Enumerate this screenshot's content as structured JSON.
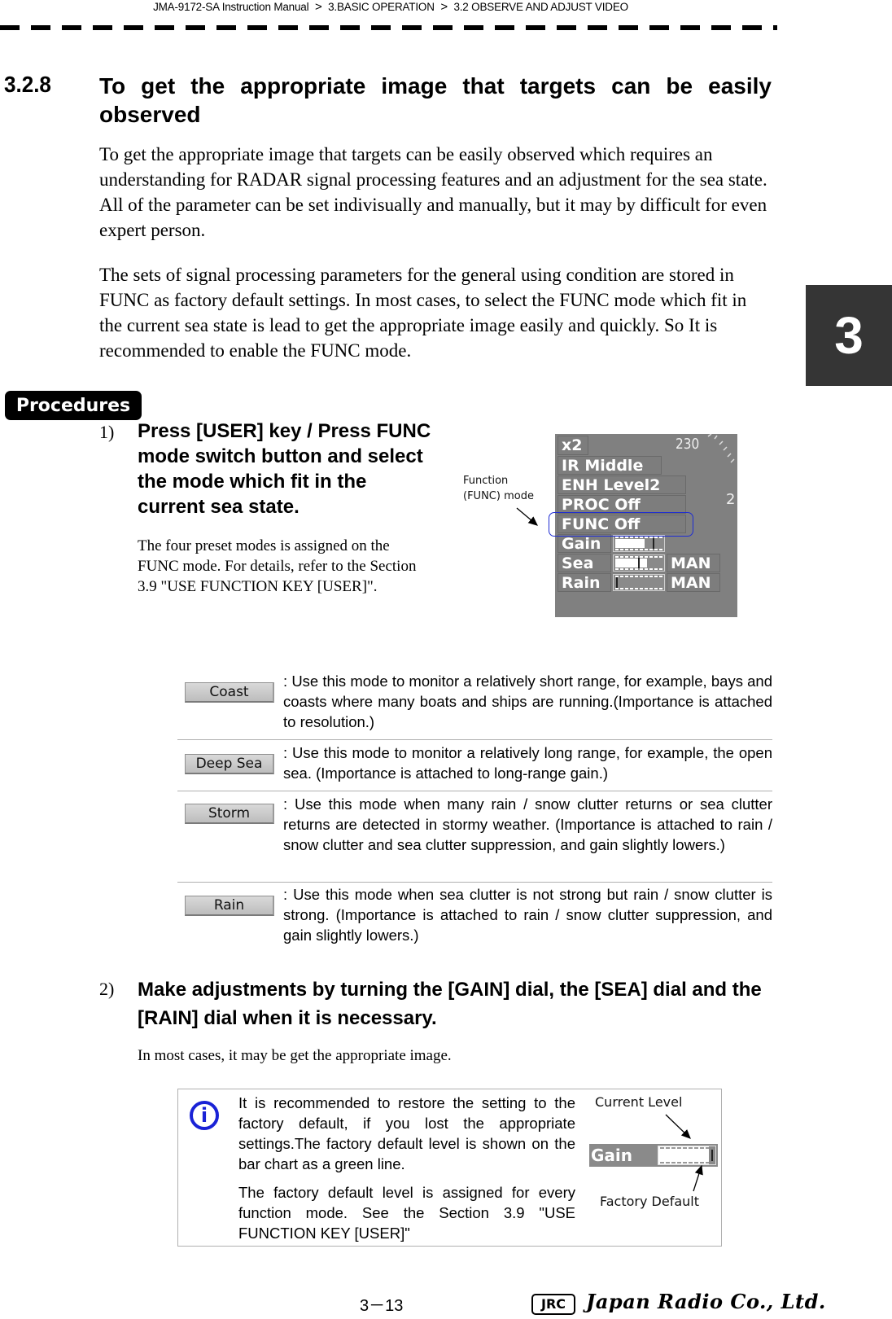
{
  "header": {
    "breadcrumb": [
      "JMA-9172-SA Instruction Manual",
      "3.BASIC OPERATION",
      "3.2  OBSERVE AND ADJUST VIDEO"
    ],
    "separator": ">"
  },
  "chapter_tab": "3",
  "section": {
    "number": "3.2.8",
    "title": "To get the appropriate image that targets can be easily observed",
    "paragraphs": [
      "To get the appropriate image that targets can be easily observed which requires an understanding for RADAR signal processing features and an adjustment for the sea state. All of the parameter can be set indivisually and manually, but it may by difficult for even expert person.",
      "The sets of signal processing parameters for the general using condition are stored in FUNC as factory default settings. In most cases, to select the FUNC mode which fit in the current sea state is lead to get the appropriate image easily and quickly. So It is recommended to enable the FUNC mode."
    ]
  },
  "procedures_label": "Procedures",
  "steps": [
    {
      "number": "1)",
      "title": "Press [USER] key / Press FUNC mode switch button and select the mode which fit in the current sea state.",
      "body": "The four preset modes is assigned on the FUNC mode. For details, refer to the Section 3.9 \"USE FUNCTION KEY [USER]\"."
    },
    {
      "number": "2)",
      "title": "Make adjustments by turning the [GAIN] dial, the [SEA] dial and the [RAIN] dial when it is necessary.",
      "body": "In most cases, it may be get the appropriate image."
    }
  ],
  "radar_figure": {
    "callout": [
      "Function",
      "(FUNC) mode"
    ],
    "range_readout": "230",
    "rows": [
      {
        "label": "x2"
      },
      {
        "label": "IR  Middle"
      },
      {
        "label": "ENH  Level2"
      },
      {
        "label": "PROC  Off"
      },
      {
        "label": "FUNC  Off"
      }
    ],
    "level_rows": [
      {
        "label": "Gain",
        "level_fraction": 0.62,
        "current_marker": 0.8,
        "mode": ""
      },
      {
        "label": "Sea",
        "level_fraction": 0.68,
        "current_marker": 0.48,
        "mode": "MAN"
      },
      {
        "label": "Rain",
        "level_fraction": 0.0,
        "current_marker": 0.02,
        "mode": "MAN"
      }
    ]
  },
  "modes": [
    {
      "button": "Coast",
      "description": ": Use this mode to monitor a relatively short range, for example, bays and coasts where many boats and ships are running.(Importance is attached to resolution.)"
    },
    {
      "button": "Deep Sea",
      "description": ": Use this mode to monitor a relatively long range, for example, the open sea. (Importance is attached to long-range gain.)"
    },
    {
      "button": "Storm",
      "description": ": Use this mode when many rain / snow clutter returns or sea clutter returns are detected in stormy weather. (Importance is attached to rain / snow clutter and sea clutter suppression, and gain slightly lowers.)"
    },
    {
      "button": "Rain",
      "description": ": Use this mode when sea clutter is not strong but rain / snow clutter is strong. (Importance is attached to rain / snow clutter suppression, and gain slightly lowers.)"
    }
  ],
  "note": {
    "icon": "info-icon",
    "paragraphs": [
      "It is recommended to restore the setting to the factory default, if you lost the appropriate settings.The factory default level is shown on the bar chart as a green line.",
      "The factory default level is assigned for every function mode. See the Section 3.9 \"USE FUNCTION KEY [USER]\""
    ],
    "figure": {
      "current_level_label": "Current Level",
      "factory_default_label": "Factory Default",
      "gain_label": "Gain"
    }
  },
  "footer": {
    "page_number": "3－13",
    "logo_badge": "JRC",
    "company": "Japan Radio Co., Ltd."
  },
  "colors": {
    "chapter_tab_bg": "#353535",
    "highlight_blue": "#1e2cd2",
    "info_icon_blue": "#1922d6",
    "radar_panel_gray": "#808080"
  }
}
